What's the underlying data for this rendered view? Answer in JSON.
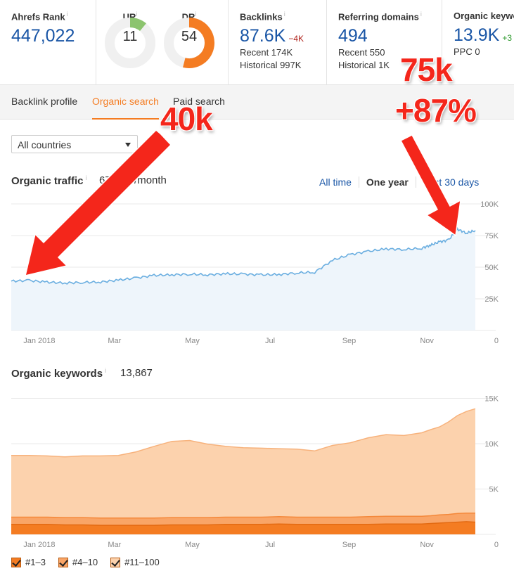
{
  "metrics": {
    "ahrefs_rank": {
      "label": "Ahrefs Rank",
      "value": "447,022",
      "info": "i"
    },
    "ur": {
      "label": "UR",
      "value": "11",
      "fraction": 0.11,
      "color": "#8cc46e",
      "info": "i"
    },
    "dr": {
      "label": "DR",
      "value": "54",
      "fraction": 0.54,
      "color": "#f47c22",
      "info": "i"
    },
    "backlinks": {
      "label": "Backlinks",
      "value": "87.6K",
      "delta": "−4K",
      "recent": "Recent 174K",
      "historical": "Historical 997K",
      "info": "i"
    },
    "referring_domains": {
      "label": "Referring domains",
      "value": "494",
      "recent": "Recent 550",
      "historical": "Historical 1K",
      "info": "i"
    },
    "organic_keywords": {
      "label": "Organic keywords",
      "value": "13.9K",
      "delta": "+3",
      "ppc": "PPC 0"
    }
  },
  "tabs": [
    {
      "label": "Backlink profile",
      "active": false
    },
    {
      "label": "Organic search",
      "active": true
    },
    {
      "label": "Paid search",
      "active": false
    }
  ],
  "country_select": {
    "value": "All countries"
  },
  "traffic": {
    "title": "Organic traffic",
    "info": "i",
    "value": "67,766 /month",
    "ranges": [
      {
        "label": "All time",
        "active": false
      },
      {
        "label": "One year",
        "active": true
      },
      {
        "label": "Last 30 days",
        "active": false
      }
    ]
  },
  "keywords": {
    "title": "Organic keywords",
    "info": "i",
    "value": "13,867"
  },
  "legend": [
    {
      "label": "#1–3",
      "color": "#f47c22"
    },
    {
      "label": "#4–10",
      "color": "#f9a567"
    },
    {
      "label": "#11–100",
      "color": "#fcd2ad"
    }
  ],
  "annotations": {
    "left": "40k",
    "right_line1": "75k",
    "right_line2": "+87%"
  },
  "chart_data": [
    {
      "type": "area",
      "title": "Organic traffic",
      "x": [
        "2017-12-10",
        "2017-12-24",
        "2018-01-07",
        "2018-01-21",
        "2018-02-04",
        "2018-02-18",
        "2018-03-04",
        "2018-03-18",
        "2018-04-01",
        "2018-04-15",
        "2018-04-29",
        "2018-05-13",
        "2018-05-27",
        "2018-06-10",
        "2018-06-24",
        "2018-07-08",
        "2018-07-22",
        "2018-08-05",
        "2018-08-19",
        "2018-09-02",
        "2018-09-16",
        "2018-09-30",
        "2018-10-14",
        "2018-10-28",
        "2018-11-04",
        "2018-11-11",
        "2018-11-18",
        "2018-11-25",
        "2018-12-02",
        "2018-12-09"
      ],
      "series": [
        {
          "name": "Organic traffic",
          "color": "#6aaee0",
          "values": [
            39000,
            39500,
            38200,
            37500,
            38000,
            38300,
            39800,
            41500,
            43500,
            44000,
            44500,
            44000,
            44800,
            44500,
            44000,
            44200,
            45500,
            46000,
            55500,
            60000,
            62500,
            64500,
            64000,
            65000,
            67500,
            70000,
            71500,
            80000,
            77000,
            79000
          ]
        }
      ],
      "xticks": [
        "Jan 2018",
        "Mar",
        "May",
        "Jul",
        "Sep",
        "Nov"
      ],
      "yticks": [
        "0",
        "25K",
        "50K",
        "75K",
        "100K"
      ],
      "ylim": [
        0,
        100000
      ],
      "grid": true,
      "y_axis_side": "right"
    },
    {
      "type": "area",
      "title": "Organic keywords",
      "stacked": true,
      "x": [
        "2017-12-10",
        "2017-12-24",
        "2018-01-07",
        "2018-01-21",
        "2018-02-04",
        "2018-02-18",
        "2018-03-04",
        "2018-03-18",
        "2018-04-01",
        "2018-04-15",
        "2018-04-29",
        "2018-05-13",
        "2018-05-27",
        "2018-06-10",
        "2018-06-24",
        "2018-07-08",
        "2018-07-22",
        "2018-08-05",
        "2018-08-19",
        "2018-09-02",
        "2018-09-16",
        "2018-09-30",
        "2018-10-14",
        "2018-10-28",
        "2018-11-04",
        "2018-11-11",
        "2018-11-18",
        "2018-11-25",
        "2018-12-02",
        "2018-12-09"
      ],
      "series": [
        {
          "name": "#1–3",
          "color": "#f47c22",
          "values": [
            1100,
            1100,
            1100,
            1050,
            1050,
            1000,
            1000,
            1000,
            1000,
            1050,
            1050,
            1050,
            1100,
            1100,
            1100,
            1150,
            1100,
            1100,
            1100,
            1100,
            1100,
            1150,
            1150,
            1150,
            1200,
            1250,
            1300,
            1350,
            1400,
            1350
          ]
        },
        {
          "name": "#4–10",
          "color": "#f9a567",
          "values": [
            800,
            800,
            800,
            800,
            800,
            800,
            800,
            800,
            800,
            800,
            800,
            800,
            800,
            800,
            800,
            800,
            800,
            800,
            800,
            800,
            850,
            850,
            850,
            850,
            850,
            900,
            900,
            950,
            950,
            1000
          ]
        },
        {
          "name": "#11–100",
          "color": "#fcd2ad",
          "values": [
            6800,
            6800,
            6750,
            6700,
            6800,
            6850,
            6900,
            7300,
            7900,
            8400,
            8500,
            8100,
            7800,
            7650,
            7600,
            7500,
            7500,
            7300,
            7900,
            8200,
            8700,
            9000,
            8900,
            9200,
            9500,
            9700,
            10200,
            10800,
            11200,
            11500
          ]
        }
      ],
      "xticks": [
        "Jan 2018",
        "Mar",
        "May",
        "Jul",
        "Sep",
        "Nov"
      ],
      "yticks": [
        "0",
        "5K",
        "10K",
        "15K"
      ],
      "ylim": [
        0,
        15500
      ],
      "grid": true,
      "legend": "bottom-left",
      "y_axis_side": "right"
    }
  ]
}
